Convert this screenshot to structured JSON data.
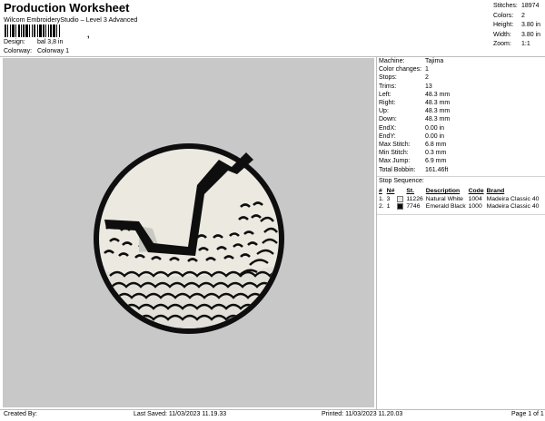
{
  "header": {
    "title": "Production Worksheet",
    "subtitle": "Wilcom EmbroideryStudio – Level 3 Advanced",
    "barcode_suffix": ",",
    "design_label": "Design:",
    "design_value": "bal 3,8 in",
    "colorway_label": "Colorway:",
    "colorway_value": "Colorway 1"
  },
  "summary": [
    {
      "label": "Stitches:",
      "value": "18974"
    },
    {
      "label": "Colors:",
      "value": "2"
    },
    {
      "label": "Height:",
      "value": "3.80 in"
    },
    {
      "label": "Width:",
      "value": "3.80 in"
    },
    {
      "label": "Zoom:",
      "value": "1:1"
    }
  ],
  "params": [
    {
      "label": "Machine:",
      "value": "Tajima"
    },
    {
      "label": "Color changes:",
      "value": "1"
    },
    {
      "label": "Stops:",
      "value": "2"
    },
    {
      "label": "Trims:",
      "value": "13"
    },
    {
      "label": "Left:",
      "value": "48.3 mm"
    },
    {
      "label": "Right:",
      "value": "48.3 mm"
    },
    {
      "label": "Up:",
      "value": "48.3 mm"
    },
    {
      "label": "Down:",
      "value": "48.3 mm"
    },
    {
      "label": "EndX:",
      "value": "0.00 in"
    },
    {
      "label": "EndY:",
      "value": "0.00 in"
    },
    {
      "label": "Max Stitch:",
      "value": "6.8 mm"
    },
    {
      "label": "Min Stitch:",
      "value": "0.3 mm"
    },
    {
      "label": "Max Jump:",
      "value": "6.9 mm"
    },
    {
      "label": "Total Bobbin:",
      "value": "161.46ft"
    }
  ],
  "stop_sequence": {
    "title": "Stop Sequence:",
    "headers": [
      "#",
      "N#",
      "",
      "St.",
      "Description",
      "Code",
      "Brand"
    ],
    "rows": [
      {
        "num": "1.",
        "needle": "3",
        "color": "#ece9e1",
        "stitches": "11226",
        "description": "Natural White",
        "code": "1004",
        "brand": "Madeira Classic 40"
      },
      {
        "num": "2.",
        "needle": "1",
        "color": "#0e0e0e",
        "stitches": "7746",
        "description": "Emerald Black",
        "code": "1000",
        "brand": "Madeira Classic 40"
      }
    ]
  },
  "footer": {
    "created": "Created By:",
    "last_saved": "Last Saved: 11/03/2023 11.19.33",
    "printed": "Printed: 11/03/2023 11.20.03",
    "page": "Page 1 of 1"
  },
  "colors": {
    "canvas_bg": "#c8c8c8",
    "thread_white": "#ece9e1",
    "thread_black": "#0e0e0e"
  }
}
